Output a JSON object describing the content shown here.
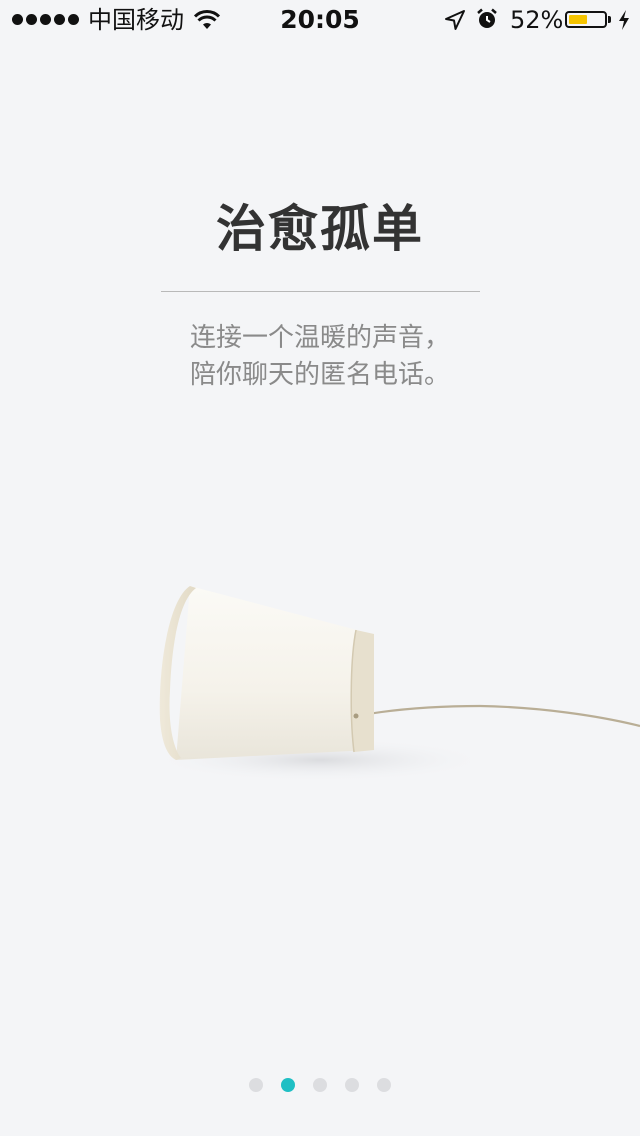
{
  "status_bar": {
    "carrier": "中国移动",
    "time": "20:05",
    "battery_percent": "52%",
    "battery_level": 0.52,
    "battery_color": "#f5c400",
    "icons": [
      "signal-dots-icon",
      "wifi-icon",
      "location-arrow-icon",
      "alarm-clock-icon",
      "battery-icon",
      "charging-bolt-icon"
    ]
  },
  "onboarding": {
    "title": "治愈孤单",
    "subtitle_line1": "连接一个温暖的声音，",
    "subtitle_line2": "陪你聊天的匿名电话。",
    "illustration": "paper-cup-phone-illustration"
  },
  "pager": {
    "total": 5,
    "current": 2,
    "active_color": "#1fbfc4",
    "inactive_color": "#dcdde0"
  }
}
